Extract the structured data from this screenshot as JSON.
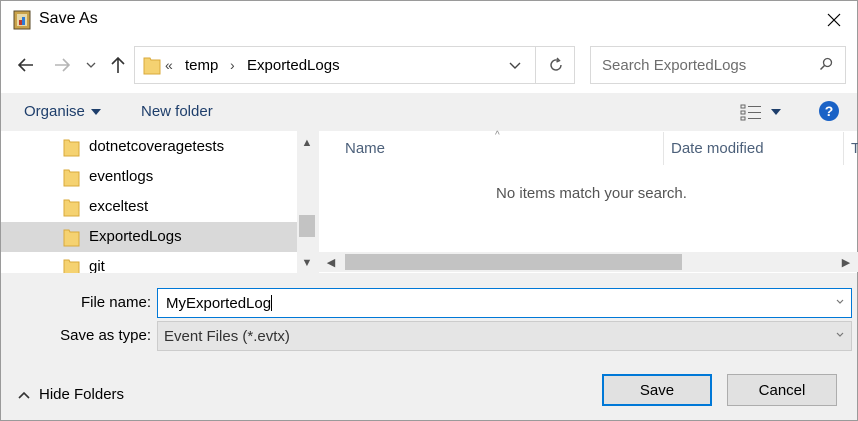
{
  "window": {
    "title": "Save As"
  },
  "address_bar": {
    "overflow": "«",
    "segments": [
      "temp",
      "ExportedLogs"
    ]
  },
  "search": {
    "placeholder": "Search ExportedLogs"
  },
  "toolbar": {
    "organise_label": "Organise",
    "new_folder_label": "New folder",
    "help_label": "?"
  },
  "folder_tree": {
    "items": [
      {
        "label": "dotnetcoveragetests"
      },
      {
        "label": "eventlogs"
      },
      {
        "label": "exceltest"
      },
      {
        "label": "ExportedLogs",
        "selected": true
      },
      {
        "label": "git"
      }
    ]
  },
  "file_list": {
    "columns": [
      "Name",
      "Date modified",
      "T"
    ],
    "empty_message": "No items match your search."
  },
  "form": {
    "file_name_label": "File name:",
    "file_name_value": "MyExportedLog",
    "save_as_type_label": "Save as type:",
    "save_as_type_value": "Event Files (*.evtx)"
  },
  "footer": {
    "hide_folders_label": "Hide Folders",
    "save_label": "Save",
    "cancel_label": "Cancel"
  },
  "colors": {
    "accent": "#0078d7",
    "link": "#1e3e6b",
    "help": "#1a62c6",
    "folder": "#f5d271",
    "selection": "#d9d9d9"
  }
}
